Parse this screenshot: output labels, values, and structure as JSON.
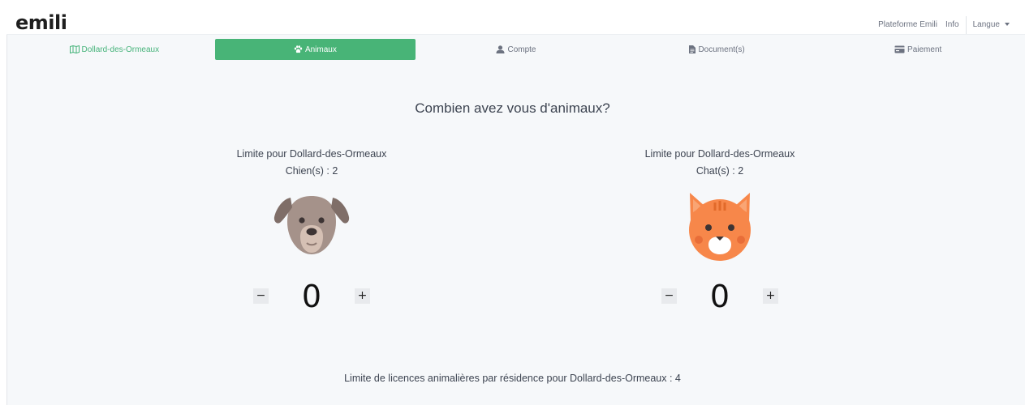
{
  "app": {
    "logo": "emili"
  },
  "topnav": {
    "platform": "Plateforme Emili",
    "info": "Info",
    "language": "Langue"
  },
  "steps": [
    {
      "label": "Dollard-des-Ormeaux",
      "icon": "map-icon",
      "state": "done"
    },
    {
      "label": "Animaux",
      "icon": "paw-icon",
      "state": "active"
    },
    {
      "label": "Compte",
      "icon": "user-icon",
      "state": "pending"
    },
    {
      "label": "Document(s)",
      "icon": "document-icon",
      "state": "pending"
    },
    {
      "label": "Paiement",
      "icon": "credit-card-icon",
      "state": "pending"
    }
  ],
  "main": {
    "question": "Combien avez vous d'animaux?",
    "dog": {
      "limit_label": "Limite pour Dollard-des-Ormeaux",
      "limit_count": "Chien(s) : 2",
      "quantity": "0",
      "icon": "dog-icon"
    },
    "cat": {
      "limit_label": "Limite pour Dollard-des-Ormeaux",
      "limit_count": "Chat(s) : 2",
      "quantity": "0",
      "icon": "cat-icon"
    },
    "minus_label": "−",
    "plus_label": "+",
    "residence_limit": "Limite de licences animalières par résidence pour Dollard-des-Ormeaux : 4"
  },
  "colors": {
    "accent": "#48b477",
    "background": "#f6f8fa",
    "cat_orange": "#f7874a",
    "dog_brown": "#a5928a"
  }
}
